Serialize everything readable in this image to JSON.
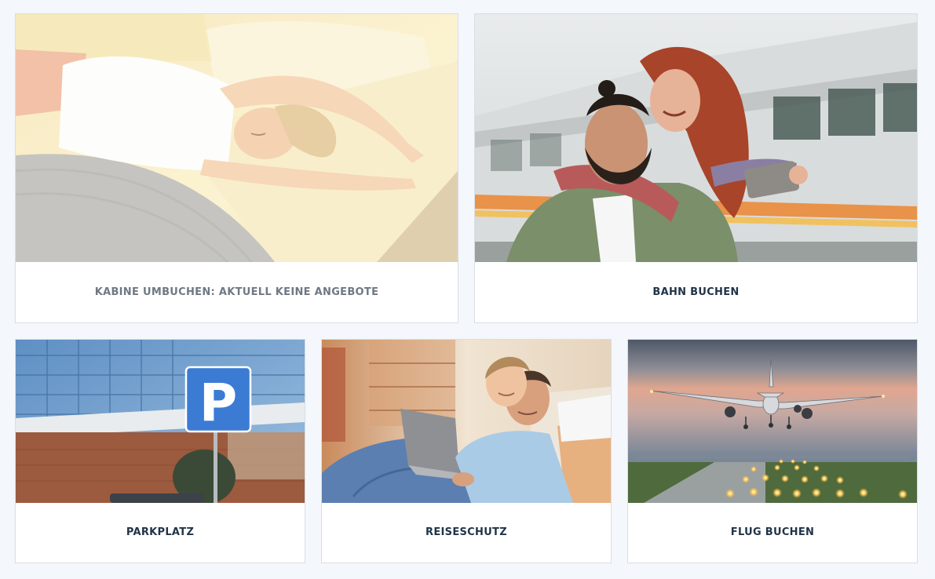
{
  "cards": {
    "kabine": {
      "label": "KABINE UMBUCHEN: AKTUELL KEINE ANGEBOTE",
      "status": "disabled"
    },
    "bahn": {
      "label": "BAHN BUCHEN"
    },
    "parkplatz": {
      "label": "PARKPLATZ",
      "sign_letter": "P"
    },
    "reiseschutz": {
      "label": "REISESCHUTZ"
    },
    "flug": {
      "label": "FLUG BUCHEN"
    }
  },
  "colors": {
    "page_background": "#f4f7fb",
    "label_text": "#213448",
    "label_text_disabled": "#6f7883",
    "card_border": "#d9dee5",
    "parking_sign_blue": "#3b7bd4"
  }
}
